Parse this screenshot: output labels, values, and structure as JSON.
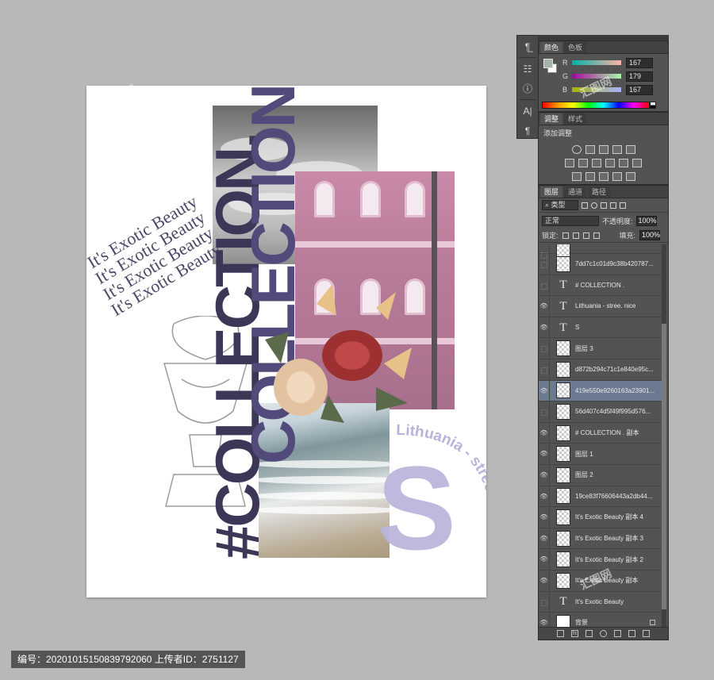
{
  "poster": {
    "vertical_text_1": "#COLLECTION.",
    "vertical_text_2": "COLLECTION.",
    "exotic_line": "It's Exotic Beauty",
    "big_letter": "S",
    "arc_text": "Lithuania - stree. nice"
  },
  "tools": {
    "icons": [
      "move-text-icon",
      "panel-icon",
      "info-icon",
      "character-icon",
      "paragraph-icon"
    ]
  },
  "color_panel": {
    "tabs": [
      "颜色",
      "色板"
    ],
    "r_label": "R",
    "r_value": "167",
    "g_label": "G",
    "g_value": "179",
    "b_label": "B",
    "b_value": "167",
    "foreground_color": "#a7b3a7"
  },
  "adjust_panel": {
    "tabs": [
      "调整",
      "样式"
    ],
    "title": "添加调整"
  },
  "layers_panel": {
    "tabs": [
      "图层",
      "通道",
      "路径"
    ],
    "filter_label": "类型",
    "blend_mode": "正常",
    "opacity_label": "不透明度:",
    "opacity_value": "100%",
    "lock_label": "锁定:",
    "fill_label": "填充:",
    "fill_value": "100%",
    "layers": [
      {
        "name": "",
        "type": "image",
        "visible": false
      },
      {
        "name": "7dd7c1c01d9c38b420787...",
        "type": "image",
        "visible": false
      },
      {
        "name": "# COLLECTION .",
        "type": "text",
        "visible": false
      },
      {
        "name": "Lithuania - stree. nice",
        "type": "text",
        "visible": true
      },
      {
        "name": "S",
        "type": "text",
        "visible": true
      },
      {
        "name": "图层 3",
        "type": "image",
        "visible": false
      },
      {
        "name": "d872b294c71c1e840e95c...",
        "type": "image",
        "visible": false
      },
      {
        "name": "419e550e9260163a23901...",
        "type": "image",
        "visible": true,
        "selected": true
      },
      {
        "name": "56d407c4d5f49f995d576...",
        "type": "image",
        "visible": false
      },
      {
        "name": "# COLLECTION . 副本",
        "type": "image",
        "visible": true
      },
      {
        "name": "图层 1",
        "type": "image",
        "visible": true
      },
      {
        "name": "图层 2",
        "type": "image",
        "visible": true
      },
      {
        "name": "19ce83f76606443a2db44...",
        "type": "image",
        "visible": true
      },
      {
        "name": "It's Exotic Beauty 副本 4",
        "type": "image",
        "visible": true
      },
      {
        "name": "It's Exotic Beauty 副本 3",
        "type": "image",
        "visible": true
      },
      {
        "name": "It's Exotic Beauty 副本 2",
        "type": "image",
        "visible": true
      },
      {
        "name": "It's Exotic Beauty 副本",
        "type": "image",
        "visible": true
      },
      {
        "name": "It's Exotic Beauty",
        "type": "text",
        "visible": false
      },
      {
        "name": "背景",
        "type": "solid",
        "visible": true,
        "locked": true
      }
    ],
    "footer_icons": [
      "link-icon",
      "fx-icon",
      "mask-icon",
      "adjustment-icon",
      "folder-icon",
      "new-layer-icon",
      "trash-icon"
    ]
  },
  "info_bar": {
    "text": "编号：20201015150839792060 上传者ID：2751127"
  }
}
